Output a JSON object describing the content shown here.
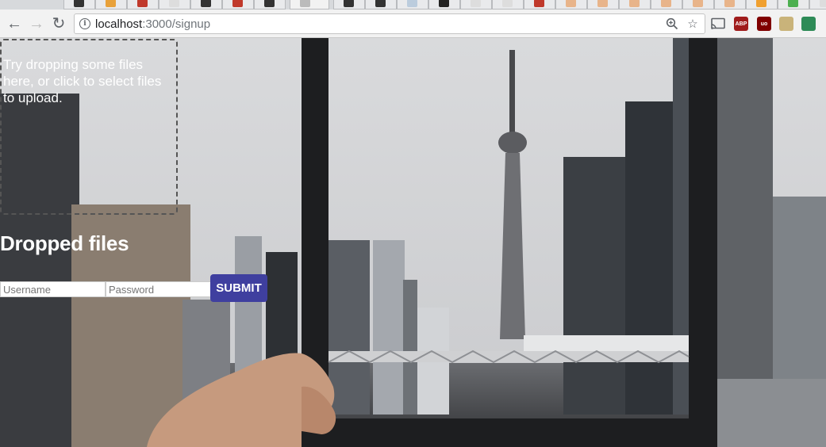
{
  "browser": {
    "url_host": "localhost",
    "url_path": ":3000/signup",
    "extensions": [
      {
        "name": "abp-icon",
        "label": "ABP",
        "color": "#a01c1c"
      },
      {
        "name": "ublock-icon",
        "label": "uo",
        "color": "#800000"
      },
      {
        "name": "image-ext-icon",
        "label": "",
        "color": "#c9b37a"
      },
      {
        "name": "mail-ext-icon",
        "label": "",
        "color": "#2e8b57"
      }
    ]
  },
  "page": {
    "dropzone_text": "Try dropping some files here, or click to select files to upload.",
    "dropped_files_heading": "Dropped files",
    "username_placeholder": "Username",
    "password_placeholder": "Password",
    "submit_label": "SUBMIT"
  },
  "colors": {
    "submit_button": "#3f3f9f",
    "dropzone_border": "#555555",
    "text": "#ffffff"
  }
}
